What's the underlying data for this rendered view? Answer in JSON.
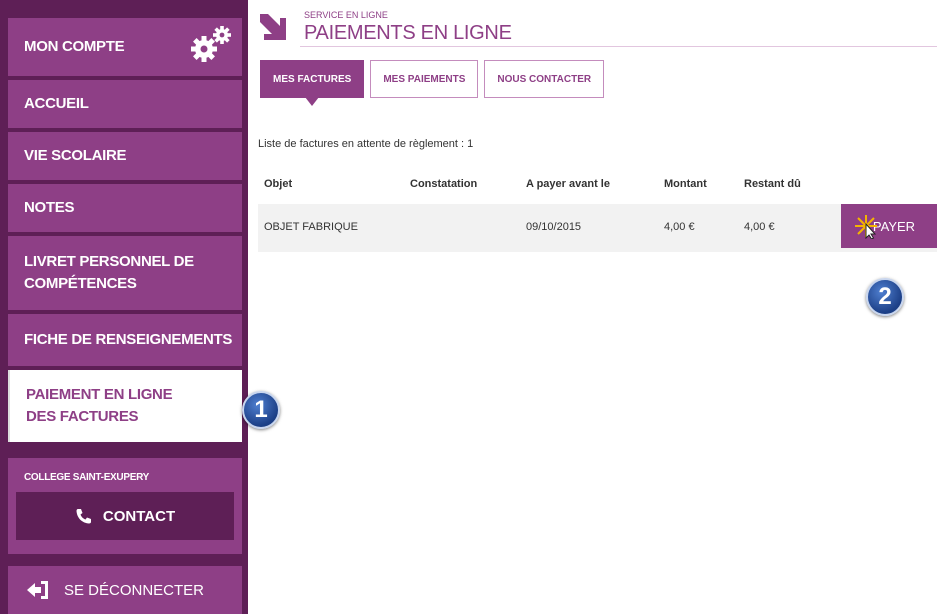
{
  "sidebar": {
    "account_label": "MON COMPTE",
    "items": [
      {
        "label": "ACCUEIL"
      },
      {
        "label": "VIE SCOLAIRE"
      },
      {
        "label": "NOTES"
      },
      {
        "label": "LIVRET PERSONNEL DE COMPÉTENCES"
      },
      {
        "label": "FICHE DE RENSEIGNEMENTS"
      },
      {
        "label": "PAIEMENT EN LIGNE DES FACTURES"
      }
    ],
    "school_name": "COLLEGE SAINT-EXUPERY",
    "contact_label": "CONTACT",
    "logout_label": "SE DÉCONNECTER"
  },
  "header": {
    "subtitle": "SERVICE EN LIGNE",
    "title": "PAIEMENTS EN LIGNE"
  },
  "tabs": [
    {
      "label": "MES FACTURES",
      "active": true
    },
    {
      "label": "MES PAIEMENTS",
      "active": false
    },
    {
      "label": "NOUS CONTACTER",
      "active": false
    }
  ],
  "invoices": {
    "caption": "Liste de factures en attente de règlement : 1",
    "columns": [
      "Objet",
      "Constatation",
      "A payer avant le",
      "Montant",
      "Restant dû"
    ],
    "rows": [
      {
        "objet": "OBJET FABRIQUE",
        "constatation": "",
        "due_date": "09/10/2015",
        "montant": "4,00 €",
        "restant": "4,00 €",
        "action": "PAYER"
      }
    ]
  },
  "callouts": [
    "1",
    "2"
  ],
  "colors": {
    "accent": "#8e3f86",
    "dark": "#5e1f56",
    "badge": "#1c3f86"
  }
}
